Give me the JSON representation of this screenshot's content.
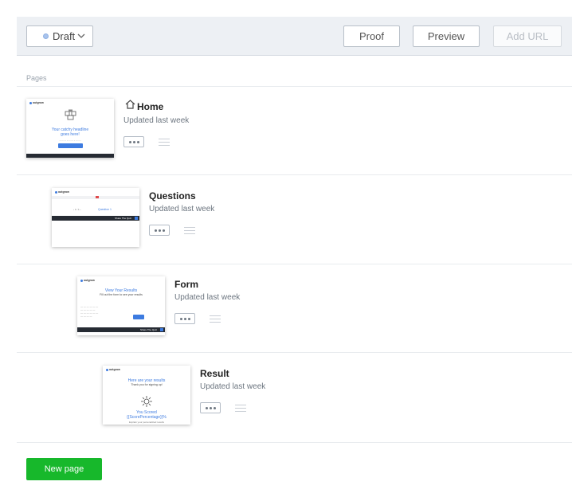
{
  "toolbar": {
    "status_label": "Draft",
    "proof_label": "Proof",
    "preview_label": "Preview",
    "add_url_label": "Add URL"
  },
  "pages_heading": "Pages",
  "pages": [
    {
      "name": "Home",
      "updated": "Updated last week",
      "thumb": {
        "logo": "outgrow",
        "headline": "Your catchy headline goes here!",
        "cta": "Let's get started"
      }
    },
    {
      "name": "Questions",
      "updated": "Updated last week",
      "thumb": {
        "logo": "outgrow",
        "question": "Question 1",
        "footer": "Share The Quiz"
      }
    },
    {
      "name": "Form",
      "updated": "Updated last week",
      "thumb": {
        "logo": "outgrow",
        "headline": "View Your Results",
        "sub": "Fill out the form to see your results",
        "footer": "Share The Quiz"
      }
    },
    {
      "name": "Result",
      "updated": "Updated last week",
      "thumb": {
        "logo": "outgrow",
        "headline": "Here are your results",
        "sub": "Thank you for signing up!",
        "score_line1": "You Scored",
        "score_line2": "{{ScorePercentage}}%",
        "desc": "Explain your personalized results"
      }
    }
  ],
  "new_page_label": "New page",
  "colors": {
    "toolbar_bg": "#edf0f4",
    "accent_blue": "#3d7be0",
    "new_page_green": "#17b82b",
    "status_dot": "#a9c3ec"
  }
}
